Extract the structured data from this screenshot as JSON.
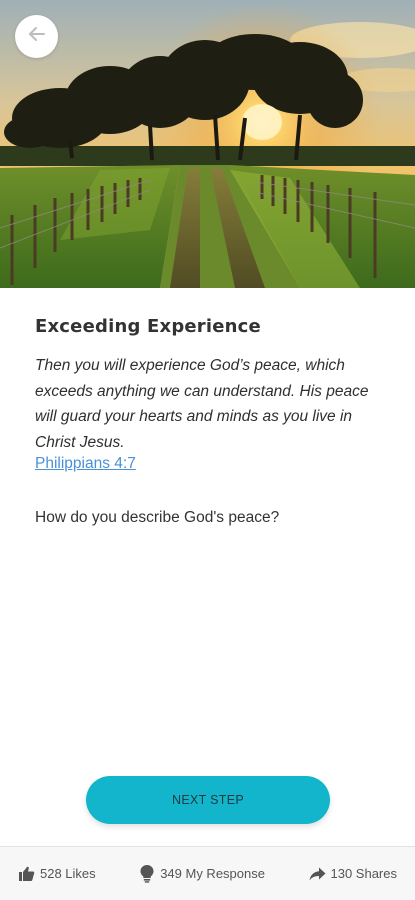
{
  "hero": {
    "image": "sunset-tree-field-photo"
  },
  "back_button": {
    "icon": "arrow-left-icon"
  },
  "devotion": {
    "title": "Exceeding Experience",
    "verse": "Then you will experience God’s peace, which exceeds anything we can understand. His peace will guard your hearts and minds as you live in Christ Jesus.",
    "reference": "Philippians 4:7",
    "question": "How do you describe God's peace?"
  },
  "next_button": {
    "label": "NEXT STEP"
  },
  "bottom_bar": {
    "likes": "528 Likes",
    "responses": "349 My Response",
    "shares": "130 Shares"
  },
  "colors": {
    "accent": "#12b5cb",
    "link": "#4a90d9"
  }
}
